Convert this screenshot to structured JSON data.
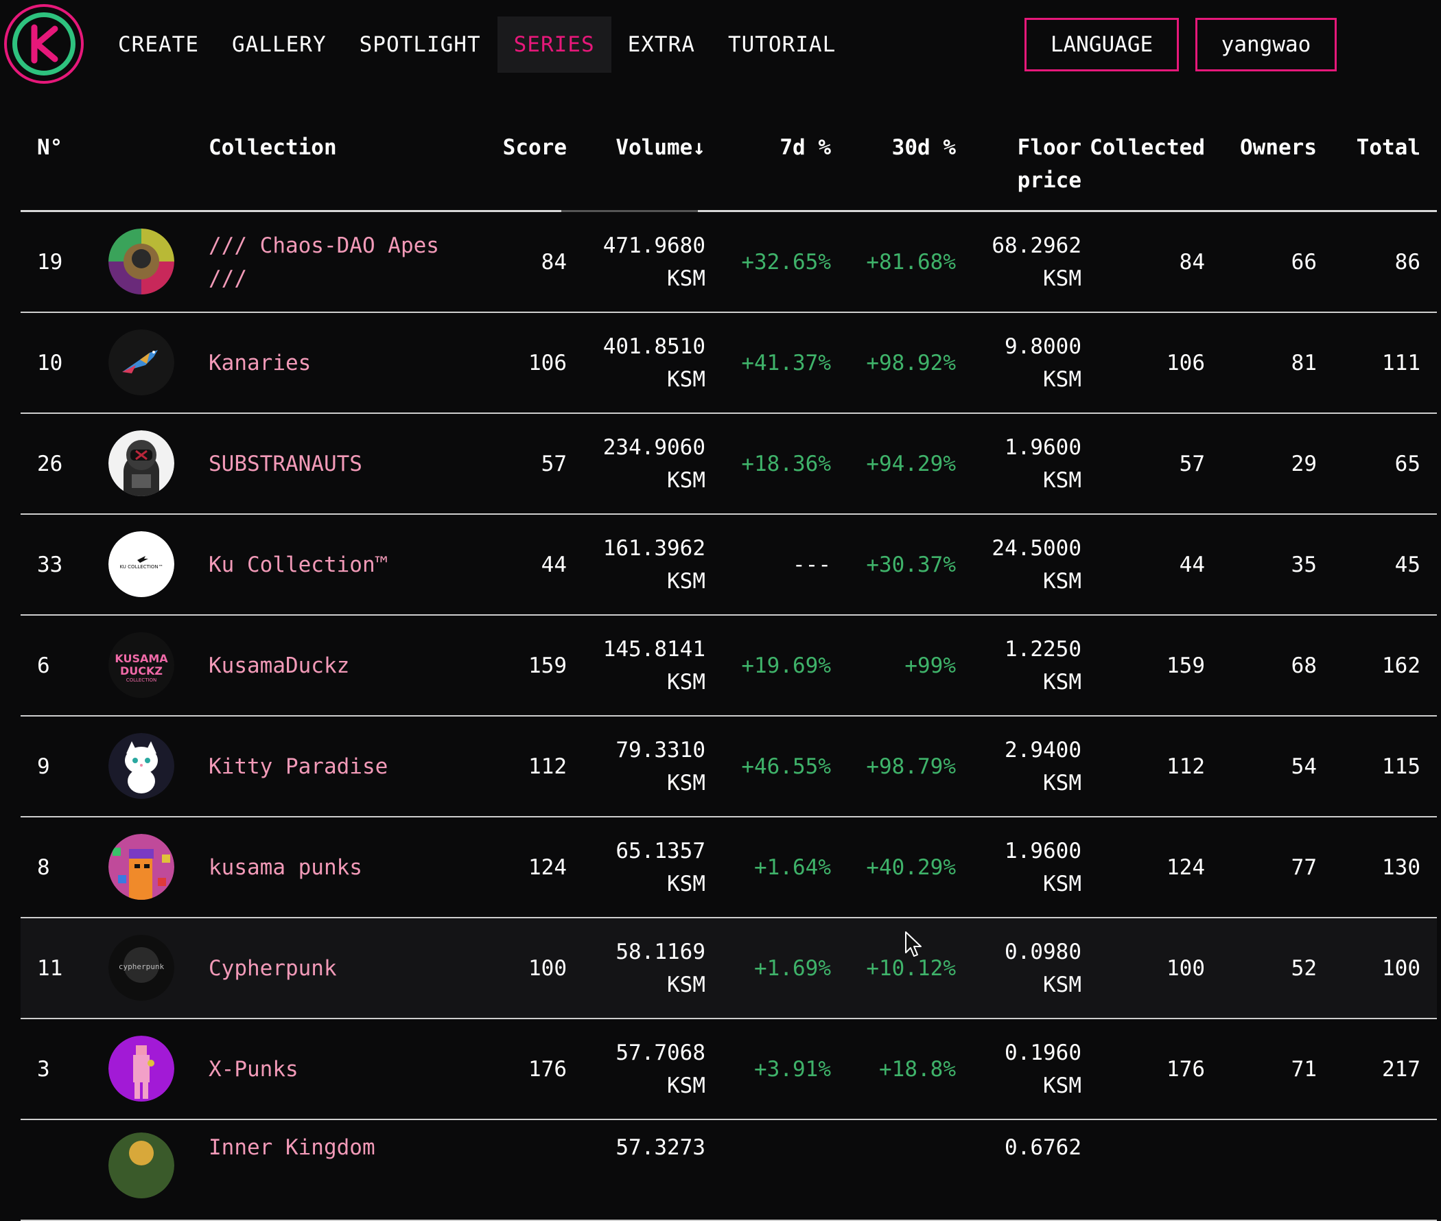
{
  "nav": {
    "items": [
      {
        "label": "CREATE"
      },
      {
        "label": "GALLERY"
      },
      {
        "label": "SPOTLIGHT"
      },
      {
        "label": "SERIES"
      },
      {
        "label": "EXTRA"
      },
      {
        "label": "TUTORIAL"
      }
    ],
    "active": "SERIES",
    "language_label": "LANGUAGE",
    "user_label": "yangwao"
  },
  "colors": {
    "accent": "#e6187a",
    "positive": "#3fb36a",
    "collection_name": "#f29ab8",
    "background": "#0a0a0b"
  },
  "table": {
    "headers": {
      "num": "N°",
      "collection": "Collection",
      "score": "Score",
      "volume": "Volume↓",
      "d7": "7d %",
      "d30": "30d %",
      "floor": "Floor\nprice",
      "collected": "Collected",
      "owners": "Owners",
      "total": "Total"
    },
    "sorted_by": "Volume",
    "rows": [
      {
        "num": "19",
        "name": "/// Chaos-DAO Apes ///",
        "score": "84",
        "volume": "471.9680",
        "volume_unit": "KSM",
        "d7": "+32.65%",
        "d30": "+81.68%",
        "floor": "68.2962",
        "floor_unit": "KSM",
        "collected": "84",
        "owners": "66",
        "total": "86",
        "avatar_icon": "chaos-dao-apes-avatar"
      },
      {
        "num": "10",
        "name": "Kanaries",
        "score": "106",
        "volume": "401.8510",
        "volume_unit": "KSM",
        "d7": "+41.37%",
        "d30": "+98.92%",
        "floor": "9.8000",
        "floor_unit": "KSM",
        "collected": "106",
        "owners": "81",
        "total": "111",
        "avatar_icon": "kanaries-bird-avatar"
      },
      {
        "num": "26",
        "name": "SUBSTRANAUTS",
        "score": "57",
        "volume": "234.9060",
        "volume_unit": "KSM",
        "d7": "+18.36%",
        "d30": "+94.29%",
        "floor": "1.9600",
        "floor_unit": "KSM",
        "collected": "57",
        "owners": "29",
        "total": "65",
        "avatar_icon": "substranauts-astronaut-avatar"
      },
      {
        "num": "33",
        "name": "Ku Collection™",
        "score": "44",
        "volume": "161.3962",
        "volume_unit": "KSM",
        "d7": "---",
        "d30": "+30.37%",
        "floor": "24.5000",
        "floor_unit": "KSM",
        "collected": "44",
        "owners": "35",
        "total": "45",
        "avatar_icon": "ku-collection-avatar",
        "avatar_text": "KU COLLECTION™"
      },
      {
        "num": "6",
        "name": "KusamaDuckz",
        "score": "159",
        "volume": "145.8141",
        "volume_unit": "KSM",
        "d7": "+19.69%",
        "d30": "+99%",
        "floor": "1.2250",
        "floor_unit": "KSM",
        "collected": "159",
        "owners": "68",
        "total": "162",
        "avatar_icon": "kusama-duckz-avatar",
        "avatar_text": "KUSAMA DUCKZ COLLECTION"
      },
      {
        "num": "9",
        "name": "Kitty Paradise",
        "score": "112",
        "volume": "79.3310",
        "volume_unit": "KSM",
        "d7": "+46.55%",
        "d30": "+98.79%",
        "floor": "2.9400",
        "floor_unit": "KSM",
        "collected": "112",
        "owners": "54",
        "total": "115",
        "avatar_icon": "kitty-paradise-cat-avatar"
      },
      {
        "num": "8",
        "name": "kusama punks",
        "score": "124",
        "volume": "65.1357",
        "volume_unit": "KSM",
        "d7": "+1.64%",
        "d30": "+40.29%",
        "floor": "1.9600",
        "floor_unit": "KSM",
        "collected": "124",
        "owners": "77",
        "total": "130",
        "avatar_icon": "kusama-punks-avatar"
      },
      {
        "num": "11",
        "name": "Cypherpunk",
        "score": "100",
        "volume": "58.1169",
        "volume_unit": "KSM",
        "d7": "+1.69%",
        "d30": "+10.12%",
        "floor": "0.0980",
        "floor_unit": "KSM",
        "collected": "100",
        "owners": "52",
        "total": "100",
        "avatar_icon": "cypherpunk-avatar",
        "avatar_text": "cypherpunk"
      },
      {
        "num": "3",
        "name": "X-Punks",
        "score": "176",
        "volume": "57.7068",
        "volume_unit": "KSM",
        "d7": "+3.91%",
        "d30": "+18.8%",
        "floor": "0.1960",
        "floor_unit": "KSM",
        "collected": "176",
        "owners": "71",
        "total": "217",
        "avatar_icon": "x-punks-avatar"
      },
      {
        "num": "",
        "name": "Inner Kingdom",
        "score": "",
        "volume": "57.3273",
        "volume_unit": "",
        "d7": "",
        "d30": "",
        "floor": "0.6762",
        "floor_unit": "",
        "collected": "",
        "owners": "",
        "total": "",
        "avatar_icon": "inner-kingdom-avatar"
      }
    ]
  }
}
